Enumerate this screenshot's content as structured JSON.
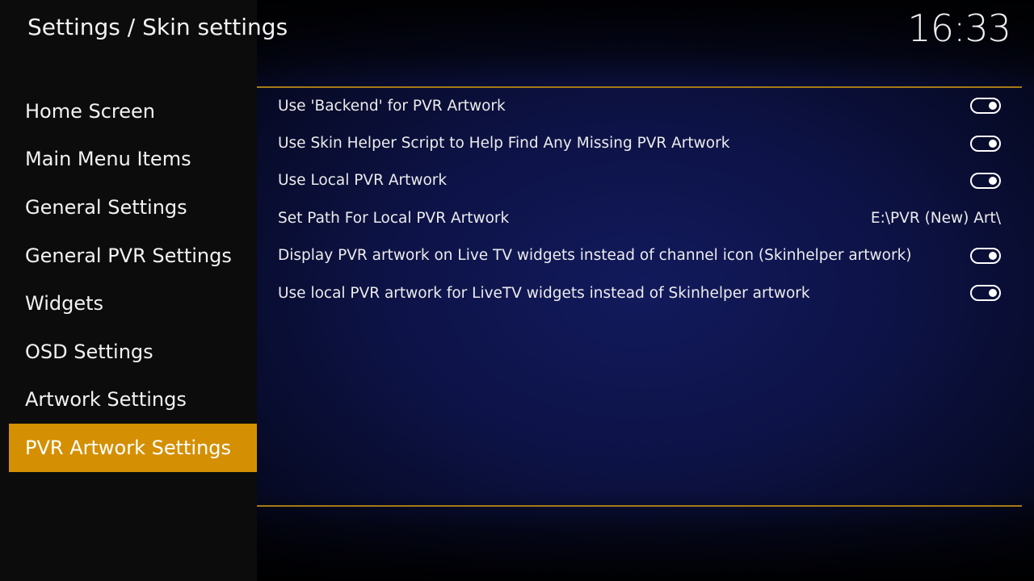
{
  "header": {
    "title": "Settings / Skin settings",
    "clock": "16:33"
  },
  "menu": {
    "items": [
      {
        "label": "Home Screen"
      },
      {
        "label": "Main Menu Items"
      },
      {
        "label": "General Settings"
      },
      {
        "label": "General PVR Settings"
      },
      {
        "label": "Widgets"
      },
      {
        "label": "OSD Settings"
      },
      {
        "label": "Artwork Settings"
      },
      {
        "label": "PVR Artwork Settings",
        "selected": true
      }
    ]
  },
  "settings": {
    "items": [
      {
        "label": "Use 'Backend' for PVR Artwork",
        "type": "toggle",
        "enabled": true
      },
      {
        "label": "Use Skin Helper Script to Help Find Any Missing PVR Artwork",
        "type": "toggle",
        "enabled": true
      },
      {
        "label": "Use Local PVR Artwork",
        "type": "toggle",
        "enabled": true
      },
      {
        "label": "Set Path For Local PVR Artwork",
        "type": "value",
        "value": "E:\\PVR (New) Art\\"
      },
      {
        "label": "Display PVR artwork on Live TV widgets instead of channel icon (Skinhelper artwork)",
        "type": "toggle",
        "enabled": true
      },
      {
        "label": "Use local PVR artwork for LiveTV widgets instead of Skinhelper artwork",
        "type": "toggle",
        "enabled": true
      }
    ]
  },
  "colors": {
    "accent": "#d58f02",
    "divider": "#a67a16",
    "background": "#0d1347"
  }
}
